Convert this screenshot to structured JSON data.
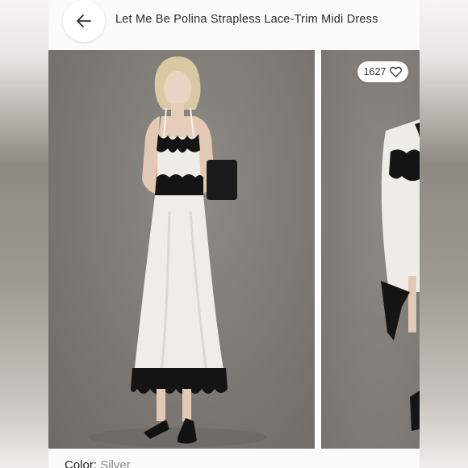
{
  "header": {
    "title": "Let Me Be Polina Strapless Lace-Trim Midi Dress"
  },
  "likes": {
    "count": "1627"
  },
  "details": {
    "color_label": "Color:",
    "color_value": "Silver"
  },
  "icons": {
    "back": "arrow-left-icon",
    "like": "heart-icon"
  },
  "colors": {
    "card_background": "#fbfbf9",
    "photo_background": "#7c7873",
    "dress": "#eeece6",
    "lace": "#141414"
  }
}
